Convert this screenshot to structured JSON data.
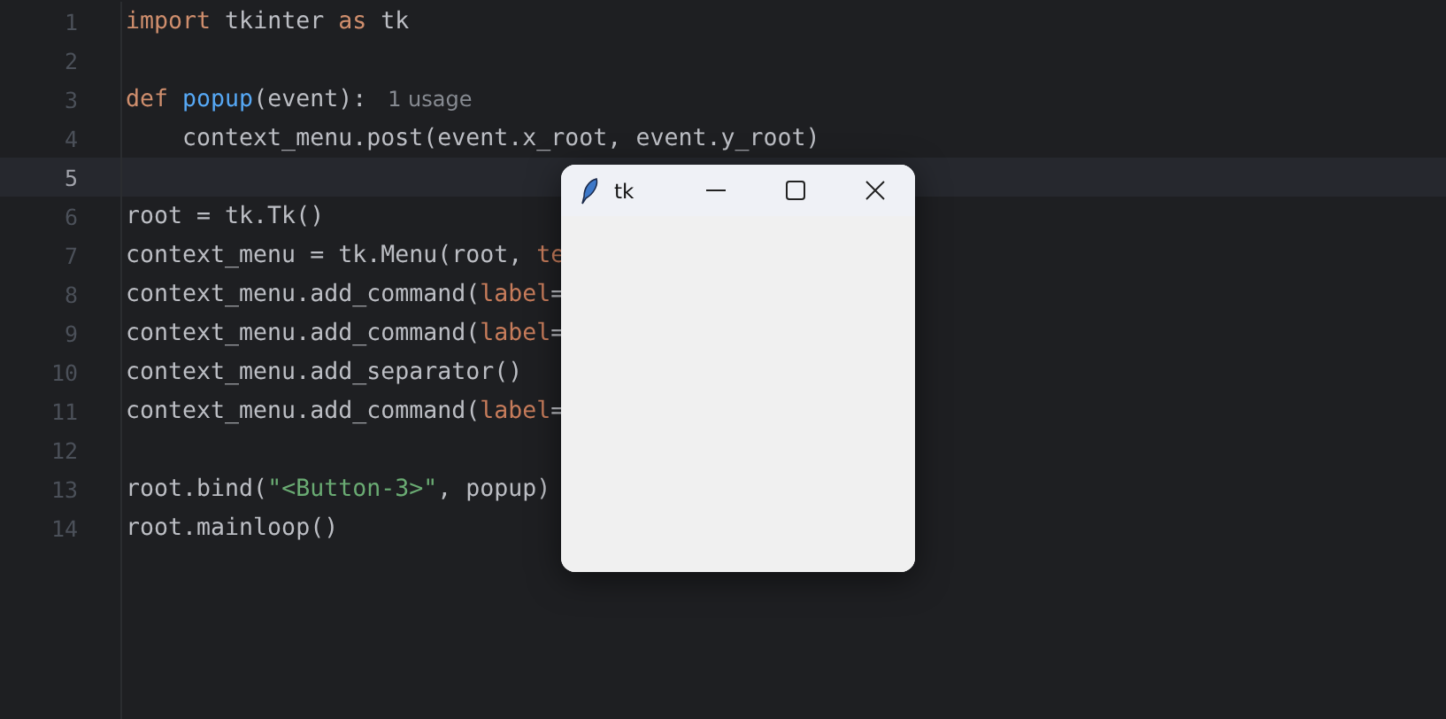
{
  "editor": {
    "lines": [
      {
        "number": "1",
        "current": false,
        "tokens": [
          {
            "kind": "keyword",
            "text": "import"
          },
          {
            "kind": "plain",
            "text": " tkinter "
          },
          {
            "kind": "keyword",
            "text": "as"
          },
          {
            "kind": "plain",
            "text": " tk"
          }
        ]
      },
      {
        "number": "2",
        "current": false
      },
      {
        "number": "3",
        "current": false,
        "tokens": [
          {
            "kind": "keyword",
            "text": "def "
          },
          {
            "kind": "function",
            "text": "popup"
          },
          {
            "kind": "plain",
            "text": "(event):"
          }
        ],
        "hint": "1 usage"
      },
      {
        "number": "4",
        "current": false,
        "tokens": [
          {
            "kind": "plain",
            "text": "    context_menu.post(event.x_root, event.y_root)"
          }
        ]
      },
      {
        "number": "5",
        "current": true
      },
      {
        "number": "6",
        "current": false,
        "tokens": [
          {
            "kind": "plain",
            "text": "root = tk.Tk()"
          }
        ]
      },
      {
        "number": "7",
        "current": false,
        "tokens": [
          {
            "kind": "plain",
            "text": "context_menu = tk.Menu(root, "
          },
          {
            "kind": "param",
            "text": "te"
          }
        ]
      },
      {
        "number": "8",
        "current": false,
        "tokens": [
          {
            "kind": "plain",
            "text": "context_menu.add_command("
          },
          {
            "kind": "param",
            "text": "label"
          },
          {
            "kind": "plain",
            "text": "="
          }
        ]
      },
      {
        "number": "9",
        "current": false,
        "tokens": [
          {
            "kind": "plain",
            "text": "context_menu.add_command("
          },
          {
            "kind": "param",
            "text": "label"
          },
          {
            "kind": "plain",
            "text": "="
          }
        ]
      },
      {
        "number": "10",
        "current": false,
        "tokens": [
          {
            "kind": "plain",
            "text": "context_menu.add_separator()"
          }
        ]
      },
      {
        "number": "11",
        "current": false,
        "tokens": [
          {
            "kind": "plain",
            "text": "context_menu.add_command("
          },
          {
            "kind": "param",
            "text": "label"
          },
          {
            "kind": "plain",
            "text": "="
          }
        ]
      },
      {
        "number": "12",
        "current": false
      },
      {
        "number": "13",
        "current": false,
        "tokens": [
          {
            "kind": "plain",
            "text": "root.bind("
          },
          {
            "kind": "string",
            "text": "\"<Button-3>\""
          },
          {
            "kind": "plain",
            "text": ", popup)"
          }
        ]
      },
      {
        "number": "14",
        "current": false,
        "tokens": [
          {
            "kind": "plain",
            "text": "root.mainloop()"
          }
        ]
      }
    ]
  },
  "tk_window": {
    "title": "tk"
  }
}
